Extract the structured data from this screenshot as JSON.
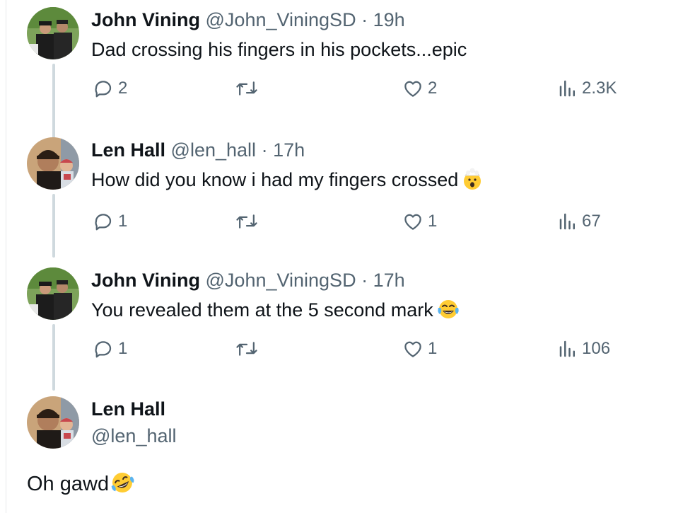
{
  "replies": [
    {
      "name": "John Vining",
      "handle": "@John_ViningSD",
      "sep": "·",
      "time": "19h",
      "text": "Dad crossing his fingers in his pockets...epic",
      "emoji": "",
      "replies": "2",
      "reposts": "",
      "likes": "2",
      "views": "2.3K"
    },
    {
      "name": "Len Hall",
      "handle": "@len_hall",
      "sep": "·",
      "time": "17h",
      "text": "How did you know i had my fingers crossed",
      "emoji": "exploding-head-emoji",
      "replies": "1",
      "reposts": "",
      "likes": "1",
      "views": "67"
    },
    {
      "name": "John Vining",
      "handle": "@John_ViningSD",
      "sep": "·",
      "time": "17h",
      "text": "You revealed them at the 5 second mark",
      "emoji": "tears-of-joy-emoji",
      "replies": "1",
      "reposts": "",
      "likes": "1",
      "views": "106"
    }
  ],
  "main_post": {
    "name": "Len Hall",
    "handle": "@len_hall",
    "text": "Oh gawd",
    "emoji": "rolling-on-floor-laughing-emoji"
  },
  "icons": {
    "reply": "reply-icon",
    "repost": "repost-icon",
    "like": "heart-icon",
    "views": "views-icon"
  },
  "colors": {
    "text": "#0f1419",
    "secondary": "#536471",
    "thread_line": "#cfd9de"
  }
}
